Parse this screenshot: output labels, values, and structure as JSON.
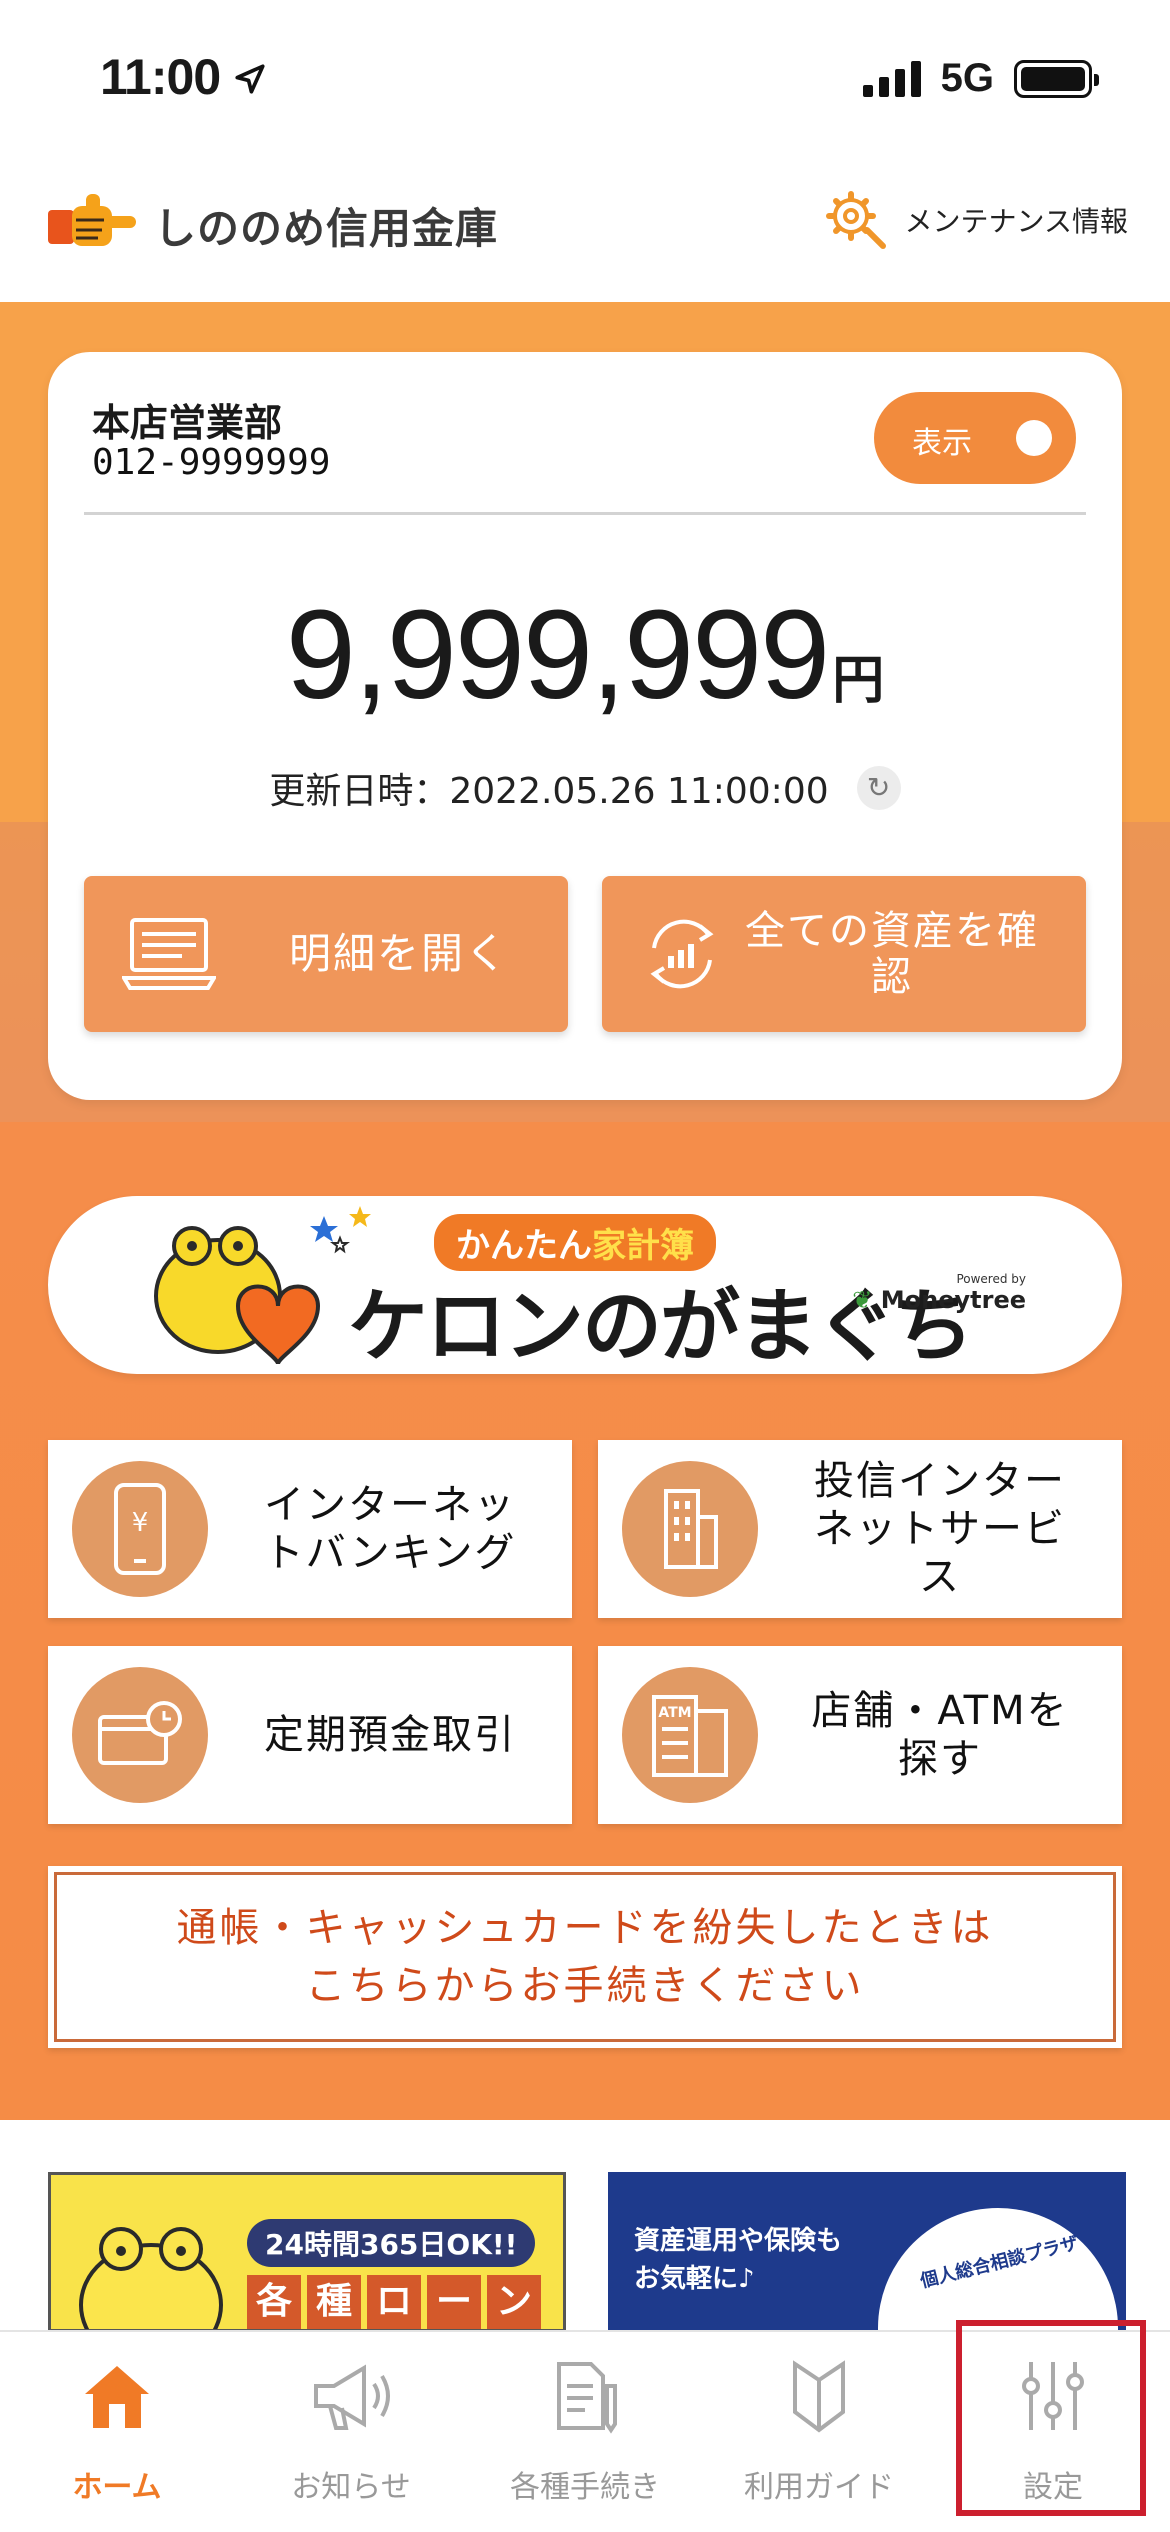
{
  "status_bar": {
    "time": "11:00",
    "network": "5G"
  },
  "header": {
    "bank_name": "しののめ信用金庫",
    "maintenance_label": "メンテナンス情報"
  },
  "account_card": {
    "branch": "本店営業部",
    "account_number": "012-9999999",
    "toggle_label": "表示",
    "balance": "9,999,999",
    "unit": "円",
    "updated": "更新日時：2022.05.26 11:00:00",
    "buttons": {
      "statement": "明細を開く",
      "assets": "全ての資産を確認"
    }
  },
  "banner": {
    "tag_prefix": "かんたん",
    "tag_highlight": "家計簿",
    "title": "ケロンのがまぐち",
    "powered_by": "Powered by",
    "powered_brand": "Moneytree"
  },
  "tiles": [
    {
      "label": "インターネットバンキング"
    },
    {
      "label": "投信インターネットサービス"
    },
    {
      "label": "定期預金取引"
    },
    {
      "label": "店舗・ATMを探す"
    }
  ],
  "lost_notice": {
    "line1": "通帳・キャッシュカードを紛失したときは",
    "line2": "こちらからお手続きください"
  },
  "promos": {
    "left": {
      "badge": "24時間365日OK!!",
      "loan": [
        "各",
        "種",
        "ロ",
        "ー",
        "ン"
      ]
    },
    "right": {
      "line1": "資産運用や保険も",
      "line2": "お気軽に♪",
      "plaza": "個人総合相談プラザ"
    }
  },
  "tabbar": {
    "items": [
      {
        "label": "ホーム",
        "icon": "home-icon",
        "active": true
      },
      {
        "label": "お知らせ",
        "icon": "megaphone-icon"
      },
      {
        "label": "各種手続き",
        "icon": "document-icon"
      },
      {
        "label": "利用ガイド",
        "icon": "guide-icon"
      },
      {
        "label": "設定",
        "icon": "sliders-icon"
      }
    ]
  },
  "colors": {
    "brand_orange": "#f07a26",
    "card_button": "#f0965a",
    "notice_red": "#cf4a1a",
    "highlight_red": "#cc1f2e"
  }
}
